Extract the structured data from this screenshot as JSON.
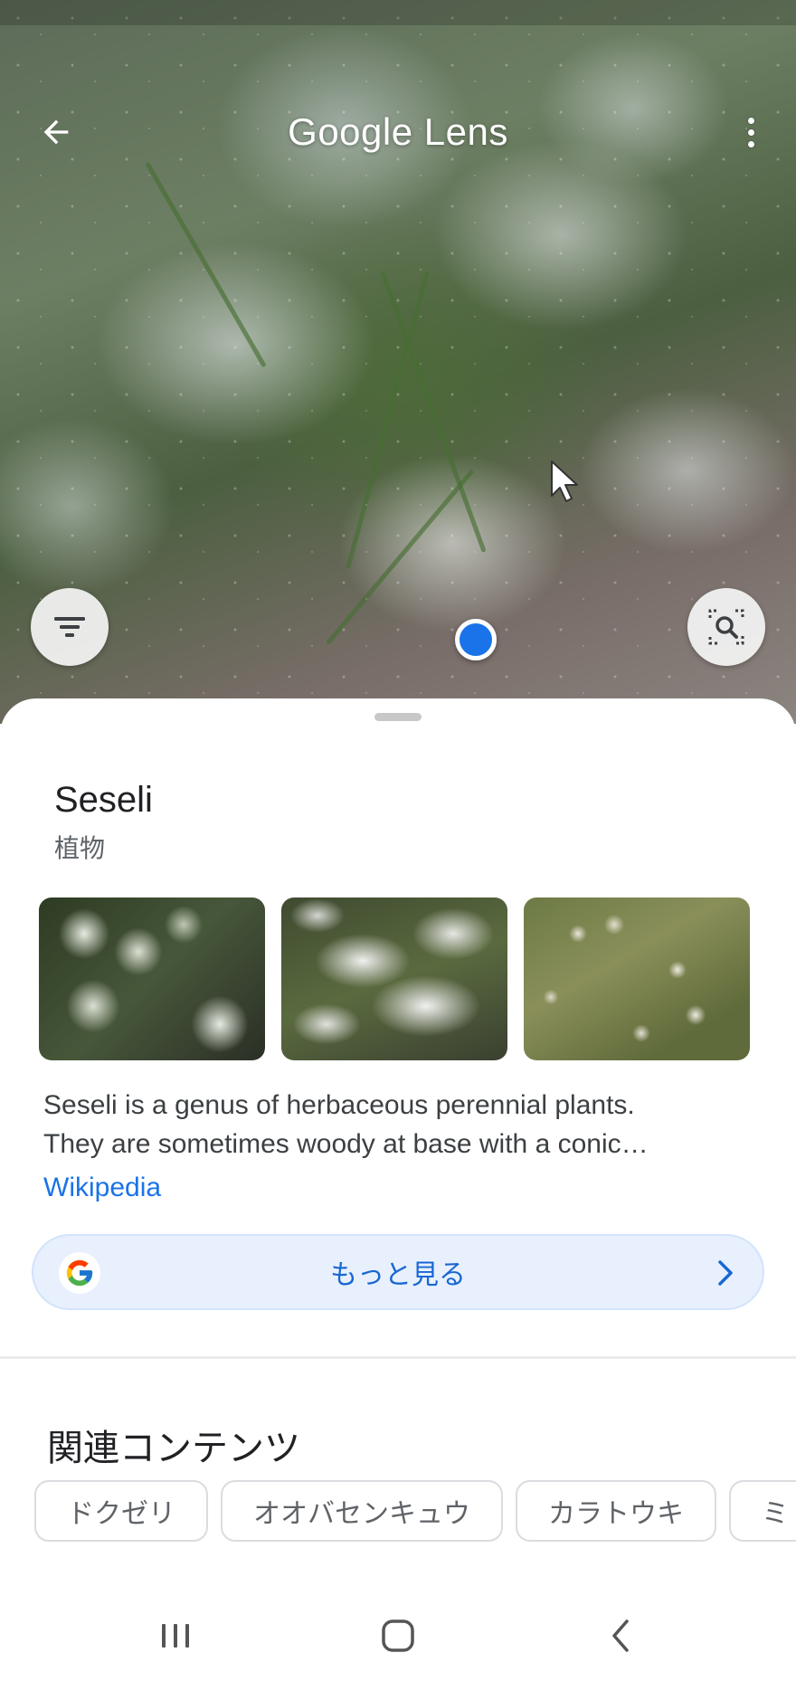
{
  "colors": {
    "accent": "#1a73e8",
    "link": "#1a73e8",
    "more_button_bg": "#e8f0fe",
    "more_button_text": "#1967d2",
    "chip_border": "#dadce0"
  },
  "header": {
    "app_title": "Google Lens",
    "back_icon": "arrow-left-icon",
    "menu_icon": "more-vertical-icon"
  },
  "camera": {
    "filter_icon": "filter-icon",
    "lens_search_icon": "image-search-icon"
  },
  "result": {
    "title": "Seseli",
    "subtitle": "植物",
    "description_lines": [
      "Seseli is a genus of herbaceous perennial plants.",
      "They are sometimes woody at base with a conic…"
    ],
    "source": "Wikipedia",
    "more_button": {
      "label": "もっと見る",
      "logo": "google-g-logo",
      "chevron": "chevron-right-icon"
    }
  },
  "related": {
    "title": "関連コンテンツ",
    "chips": [
      "ドクゼリ",
      "オオバセンキュウ",
      "カラトウキ",
      "ミ"
    ]
  },
  "navbar": {
    "recent_icon": "recent-apps-icon",
    "home_icon": "home-icon",
    "back_icon": "back-chevron-icon"
  }
}
